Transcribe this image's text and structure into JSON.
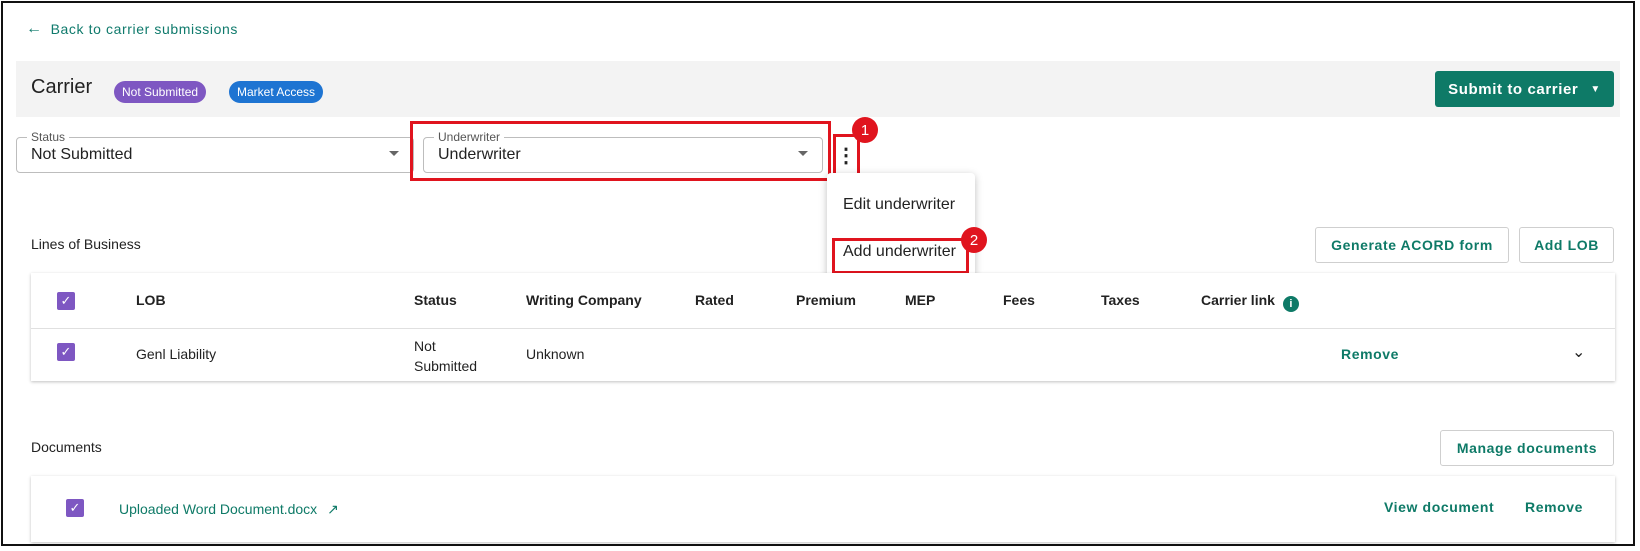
{
  "nav": {
    "back_label": "Back to carrier submissions"
  },
  "header": {
    "title": "Carrier",
    "chips": [
      "Not Submitted",
      "Market Access"
    ],
    "submit_label": "Submit to carrier"
  },
  "fields": {
    "status": {
      "label": "Status",
      "value": "Not Submitted"
    },
    "underwriter": {
      "label": "Underwriter",
      "value": "Underwriter"
    }
  },
  "menu": {
    "items": [
      "Edit underwriter",
      "Add underwriter"
    ]
  },
  "annotations": [
    "1",
    "2"
  ],
  "lob": {
    "title": "Lines of Business",
    "generate_label": "Generate ACORD form",
    "add_label": "Add LOB",
    "columns": [
      "LOB",
      "Status",
      "Writing Company",
      "Rated",
      "Premium",
      "MEP",
      "Fees",
      "Taxes",
      "Carrier link"
    ],
    "rows": [
      {
        "lob": "Genl Liability",
        "status_line1": "Not",
        "status_line2": "Submitted",
        "writing_company": "Unknown",
        "remove_label": "Remove"
      }
    ]
  },
  "documents": {
    "title": "Documents",
    "manage_label": "Manage documents",
    "rows": [
      {
        "name": "Uploaded Word Document.docx",
        "view_label": "View document",
        "remove_label": "Remove"
      }
    ]
  },
  "colors": {
    "accent": "#0e7a67",
    "purple": "#7e57c2",
    "blue": "#1e74d2",
    "highlight": "#e0141e"
  }
}
